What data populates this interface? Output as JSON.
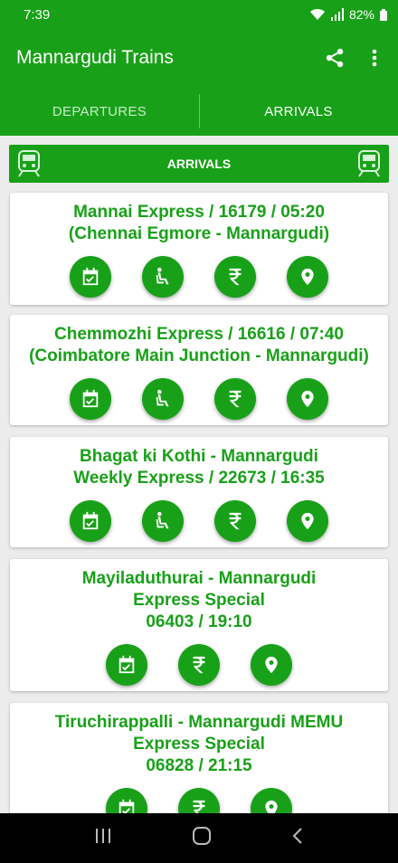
{
  "status": {
    "time": "7:39",
    "battery": "82%"
  },
  "app": {
    "title": "Mannargudi Trains"
  },
  "tabs": [
    {
      "label": "DEPARTURES",
      "active": false
    },
    {
      "label": "ARRIVALS",
      "active": true
    }
  ],
  "section": {
    "title": "ARRIVALS"
  },
  "trains": [
    {
      "lines": [
        "Mannai Express / 16179 / 05:20",
        "(Chennai Egmore - Mannargudi)"
      ],
      "actions": [
        "schedule",
        "seat",
        "fare",
        "location"
      ]
    },
    {
      "lines": [
        "Chemmozhi Express / 16616 / 07:40",
        "(Coimbatore Main Junction - Mannargudi)"
      ],
      "actions": [
        "schedule",
        "seat",
        "fare",
        "location"
      ]
    },
    {
      "lines": [
        "Bhagat ki Kothi - Mannargudi",
        "Weekly Express / 22673 / 16:35"
      ],
      "actions": [
        "schedule",
        "seat",
        "fare",
        "location"
      ]
    },
    {
      "lines": [
        "Mayiladuthurai - Mannargudi",
        "Express Special",
        "06403 / 19:10"
      ],
      "actions": [
        "schedule",
        "fare",
        "location"
      ]
    },
    {
      "lines": [
        "Tiruchirappalli - Mannargudi MEMU",
        "Express Special",
        "06828 / 21:15"
      ],
      "actions": [
        "schedule",
        "fare",
        "location"
      ]
    }
  ],
  "icons": {
    "schedule": "calendar-check-icon",
    "seat": "seat-icon",
    "fare": "rupee-icon",
    "location": "location-pin-icon"
  },
  "colors": {
    "primary": "#18a118",
    "background": "#ececec"
  }
}
